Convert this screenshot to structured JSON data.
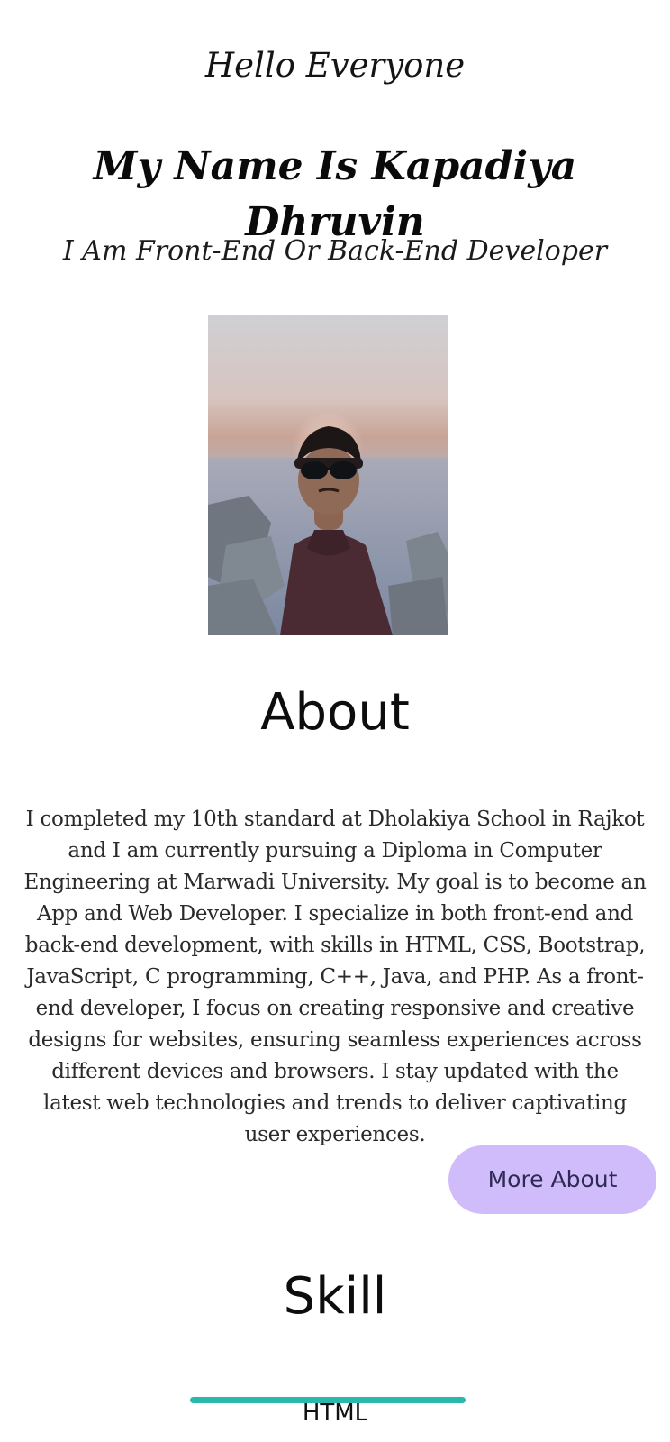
{
  "hero": {
    "greeting": "Hello Everyone",
    "name": "My Name Is Kapadiya Dhruvin",
    "role": "I Am Front-End Or Back-End Developer"
  },
  "about": {
    "heading": "About",
    "text": "I completed my 10th standard at Dholakiya School in Rajkot and I am currently pursuing a Diploma in Computer Engineering at Marwadi University. My goal is to become an App and Web Developer. I specialize in both front-end and back-end development, with skills in HTML, CSS, Bootstrap, JavaScript, C programming, C++, Java, and PHP. As a front-end developer, I focus on creating responsive and creative designs for websites, ensuring seamless experiences across different devices and browsers. I stay updated with the latest web technologies and trends to deliver captivating user experiences.",
    "button_label": "More About"
  },
  "skills": {
    "heading": "Skill",
    "items": [
      {
        "label": "HTML"
      }
    ]
  },
  "colors": {
    "button_bg": "#d0bcfa",
    "button_text": "#2e2a55",
    "skill_bar": "#2ab8ad"
  }
}
